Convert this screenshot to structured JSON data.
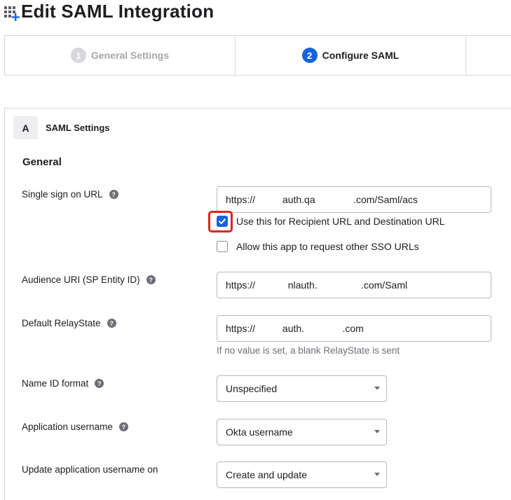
{
  "header": {
    "title": "Edit SAML Integration",
    "icon": "app-grid-plus-icon"
  },
  "wizard": {
    "steps": [
      {
        "number": "1",
        "label": "General Settings",
        "state": "completed"
      },
      {
        "number": "2",
        "label": "Configure SAML",
        "state": "active"
      }
    ]
  },
  "section": {
    "badge": "A",
    "title": "SAML Settings",
    "subheading": "General"
  },
  "fields": {
    "sso_url": {
      "label": "Single sign on URL",
      "value": "https://          auth.qa              .com/Saml/acs"
    },
    "recipient_checkbox": {
      "label": "Use this for Recipient URL and Destination URL",
      "checked": true
    },
    "other_sso_checkbox": {
      "label": "Allow this app to request other SSO URLs",
      "checked": false
    },
    "audience_uri": {
      "label": "Audience URI (SP Entity ID)",
      "value": "https://            nlauth.                .com/Saml"
    },
    "relay_state": {
      "label": "Default RelayState",
      "value": "https://          auth.              .com",
      "hint": "If no value is set, a blank RelayState is sent"
    },
    "name_id_format": {
      "label": "Name ID format",
      "selected": "Unspecified"
    },
    "app_username": {
      "label": "Application username",
      "selected": "Okta username"
    },
    "update_username_on": {
      "label": "Update application username on",
      "selected": "Create and update"
    }
  },
  "colors": {
    "accent": "#1662dd",
    "highlight": "#e0221c",
    "border": "#d7d7dc",
    "muted": "#6e6e78"
  }
}
